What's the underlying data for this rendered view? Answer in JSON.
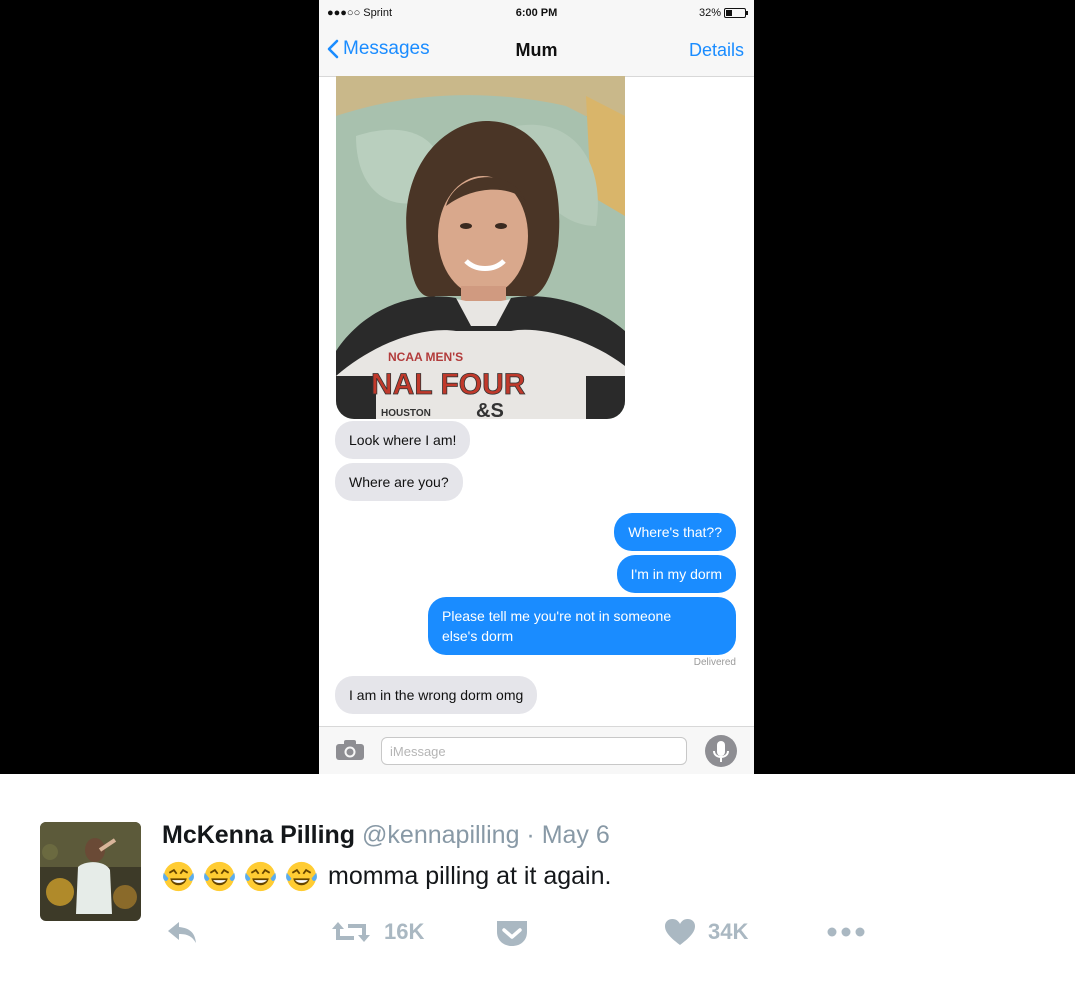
{
  "phone": {
    "status": {
      "carrier": "●●●○○ Sprint",
      "time": "6:00 PM",
      "battery": "32%"
    },
    "nav": {
      "back_label": "Messages",
      "title": "Mum",
      "details_label": "Details"
    },
    "messages": [
      {
        "from": "them",
        "text": "Look where I am!"
      },
      {
        "from": "them",
        "text": "Where are you?"
      },
      {
        "from": "me",
        "text": "Where's that??"
      },
      {
        "from": "me",
        "text": "I'm in my dorm"
      },
      {
        "from": "me",
        "text": "Please tell me you're not in someone",
        "text2": "else's dorm"
      },
      {
        "from": "them",
        "text": "I am in the wrong dorm omg"
      }
    ],
    "delivered_label": "Delivered",
    "composer": {
      "placeholder": "iMessage"
    },
    "photo_shirt_text": {
      "line1": "NCAA MEN'S",
      "line2": "NAL FOUR",
      "line3": "HOUSTON",
      "line4": "&S"
    }
  },
  "tweet": {
    "display_name": "McKenna Pilling",
    "handle": "@kennapilling",
    "separator": "·",
    "date": "May 6",
    "emoji_count": 4,
    "text": "momma pilling at it again.",
    "retweets": "16K",
    "likes": "34K"
  },
  "colors": {
    "ios_blue": "#1a8cff",
    "bubble_gray": "#e5e5ea",
    "twitter_gray": "#aab8c2"
  }
}
